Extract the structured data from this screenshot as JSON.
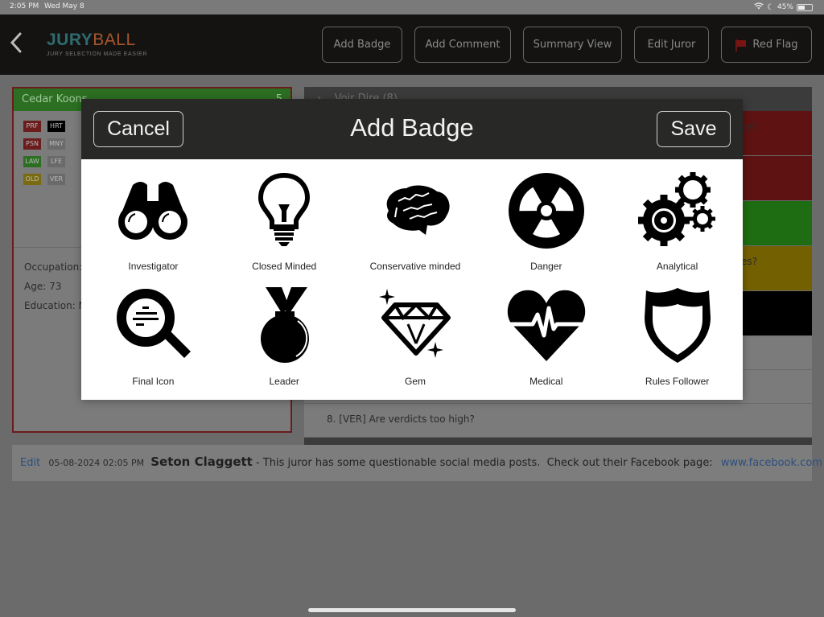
{
  "status_bar": {
    "time": "2:05 PM",
    "date": "Wed May 8",
    "battery": "45%",
    "battery_level": 0.45
  },
  "app": {
    "logo_part1": "JURY",
    "logo_part2": "BALL",
    "tagline": "JURY SELECTION MADE EASIER",
    "toolbar": [
      {
        "label": "Add Badge"
      },
      {
        "label": "Add Comment"
      },
      {
        "label": "Summary View"
      },
      {
        "label": "Edit Juror"
      },
      {
        "label": "Red Flag",
        "icon": "flag-icon",
        "icon_color": "#7a1414"
      }
    ]
  },
  "juror": {
    "name": "Cedar Koons",
    "number": "5",
    "header_color": "#2c6f22",
    "tags": [
      {
        "code": "PRF",
        "color": "#6b1c1c"
      },
      {
        "code": "HRT",
        "color": "#000000"
      },
      {
        "code": "PSN",
        "color": "#6b1c1c"
      },
      {
        "code": "MNY",
        "color": "#6a6a6a"
      },
      {
        "code": "LAW",
        "color": "#2c6f22"
      },
      {
        "code": "LFE",
        "color": "#6a6a6a"
      },
      {
        "code": "OLD",
        "color": "#7a6a10"
      },
      {
        "code": "VER",
        "color": "#6a6a6a"
      }
    ],
    "occupation_label": "Occupation: I",
    "age_label": "Age: 73",
    "education_label": "Education: M"
  },
  "questions": {
    "section_header": "Voir Dire (8)",
    "rows": [
      {
        "tail": "ney?",
        "color": "#5e1212"
      },
      {
        "tail": "",
        "color": "#5e1212"
      },
      {
        "tail": "",
        "color": "#1e6d12"
      },
      {
        "tail": "es?",
        "color": "#736000"
      },
      {
        "tail": "",
        "color": "#000000"
      }
    ],
    "plain_rows": [
      "",
      "",
      "8. [VER] Are verdicts too high?"
    ]
  },
  "comment": {
    "edit_label": "Edit",
    "timestamp": "05-08-2024 02:05 PM",
    "author": "Seton Claggett",
    "text": " - This juror has some questionable social media posts.  Check out their Facebook page: ",
    "link": "www.facebook.com"
  },
  "modal": {
    "title": "Add Badge",
    "cancel_label": "Cancel",
    "save_label": "Save",
    "badges": [
      {
        "label": "Investigator",
        "icon": "binoculars-icon"
      },
      {
        "label": "Closed Minded",
        "icon": "lightbulb-icon"
      },
      {
        "label": "Conservative minded",
        "icon": "brain-icon"
      },
      {
        "label": "Danger",
        "icon": "radiation-icon"
      },
      {
        "label": "Analytical",
        "icon": "gears-icon"
      },
      {
        "label": "Final Icon",
        "icon": "magnifier-icon"
      },
      {
        "label": "Leader",
        "icon": "medal-icon"
      },
      {
        "label": "Gem",
        "icon": "diamond-icon"
      },
      {
        "label": "Medical",
        "icon": "heart-pulse-icon"
      },
      {
        "label": "Rules Follower",
        "icon": "shield-icon"
      }
    ]
  }
}
